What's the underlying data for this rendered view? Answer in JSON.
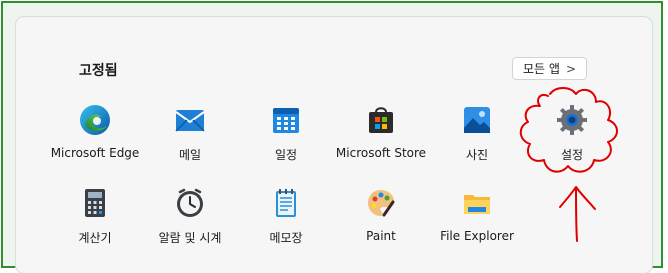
{
  "start_menu": {
    "pinned_title": "고정됨",
    "all_apps_label": "모든 앱",
    "all_apps_chevron": ">",
    "apps_row1": [
      {
        "label": "Microsoft Edge",
        "icon": "edge-icon"
      },
      {
        "label": "메일",
        "icon": "mail-icon"
      },
      {
        "label": "일정",
        "icon": "calendar-icon"
      },
      {
        "label": "Microsoft Store",
        "icon": "store-icon"
      },
      {
        "label": "사진",
        "icon": "photos-icon"
      },
      {
        "label": "설정",
        "icon": "settings-gear-icon"
      }
    ],
    "apps_row2": [
      {
        "label": "계산기",
        "icon": "calculator-icon"
      },
      {
        "label": "알람 및 시계",
        "icon": "alarm-clock-icon"
      },
      {
        "label": "메모장",
        "icon": "notepad-icon"
      },
      {
        "label": "Paint",
        "icon": "paint-icon"
      },
      {
        "label": "File Explorer",
        "icon": "file-explorer-icon"
      }
    ]
  },
  "colors": {
    "frame_border": "#2f8f2f",
    "annotation_red": "#e00000",
    "panel_bg": "#f6f6f6"
  }
}
